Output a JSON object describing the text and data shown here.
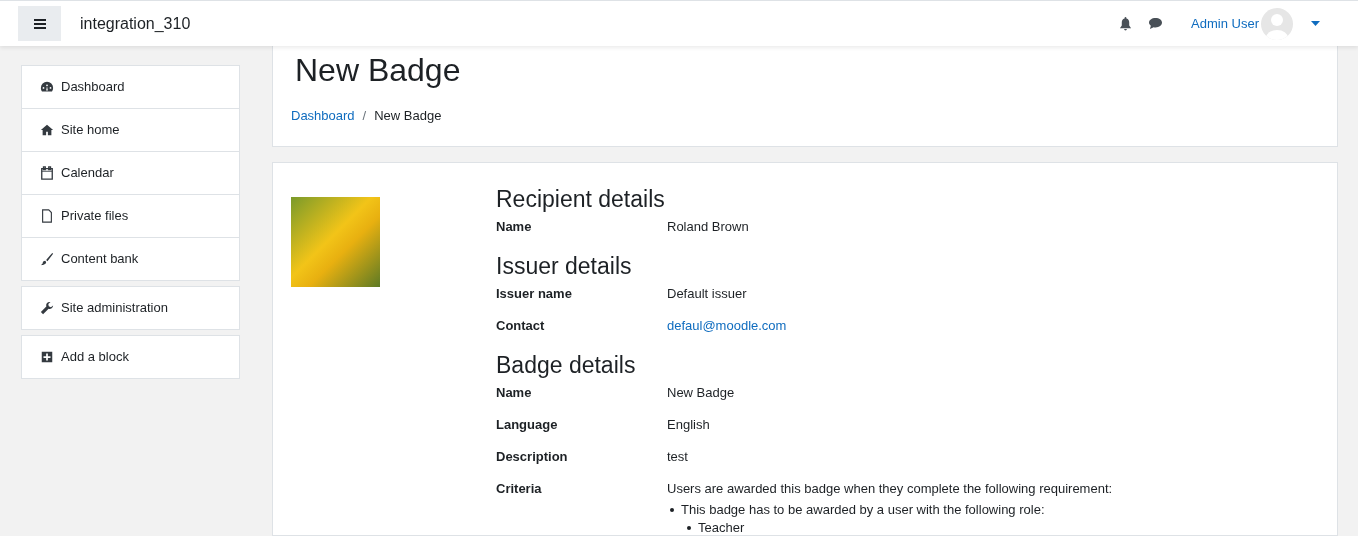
{
  "navbar": {
    "site_name": "integration_310",
    "user_name": "Admin User"
  },
  "sidebar": {
    "blocks": [
      [
        {
          "label": "Dashboard"
        },
        {
          "label": "Site home"
        },
        {
          "label": "Calendar"
        },
        {
          "label": "Private files"
        },
        {
          "label": "Content bank"
        }
      ],
      [
        {
          "label": "Site administration"
        }
      ],
      [
        {
          "label": "Add a block"
        }
      ]
    ]
  },
  "page": {
    "title": "New Badge",
    "breadcrumb": [
      {
        "label": "Dashboard",
        "kind": "link"
      },
      {
        "label": "/",
        "kind": "separator"
      },
      {
        "label": "New Badge",
        "kind": "current"
      }
    ]
  },
  "sections": [
    {
      "heading": "Recipient details",
      "rows": [
        {
          "label": "Name",
          "value": "Roland Brown"
        }
      ]
    },
    {
      "heading": "Issuer details",
      "rows": [
        {
          "label": "Issuer name",
          "value": "Default issuer"
        },
        {
          "label": "Contact",
          "value": "defaul@moodle.com",
          "kind": "link"
        }
      ]
    },
    {
      "heading": "Badge details",
      "rows": [
        {
          "label": "Name",
          "value": "New Badge"
        },
        {
          "label": "Language",
          "value": "English"
        },
        {
          "label": "Description",
          "value": "test"
        },
        {
          "label": "Criteria",
          "value": "Users are awarded this badge when they complete the following requirement:",
          "kind": "criteria",
          "items": [
            {
              "text": "This badge has to be awarded by a user with the following role:",
              "children": [
                {
                  "text": "Teacher"
                }
              ]
            }
          ]
        }
      ]
    }
  ]
}
